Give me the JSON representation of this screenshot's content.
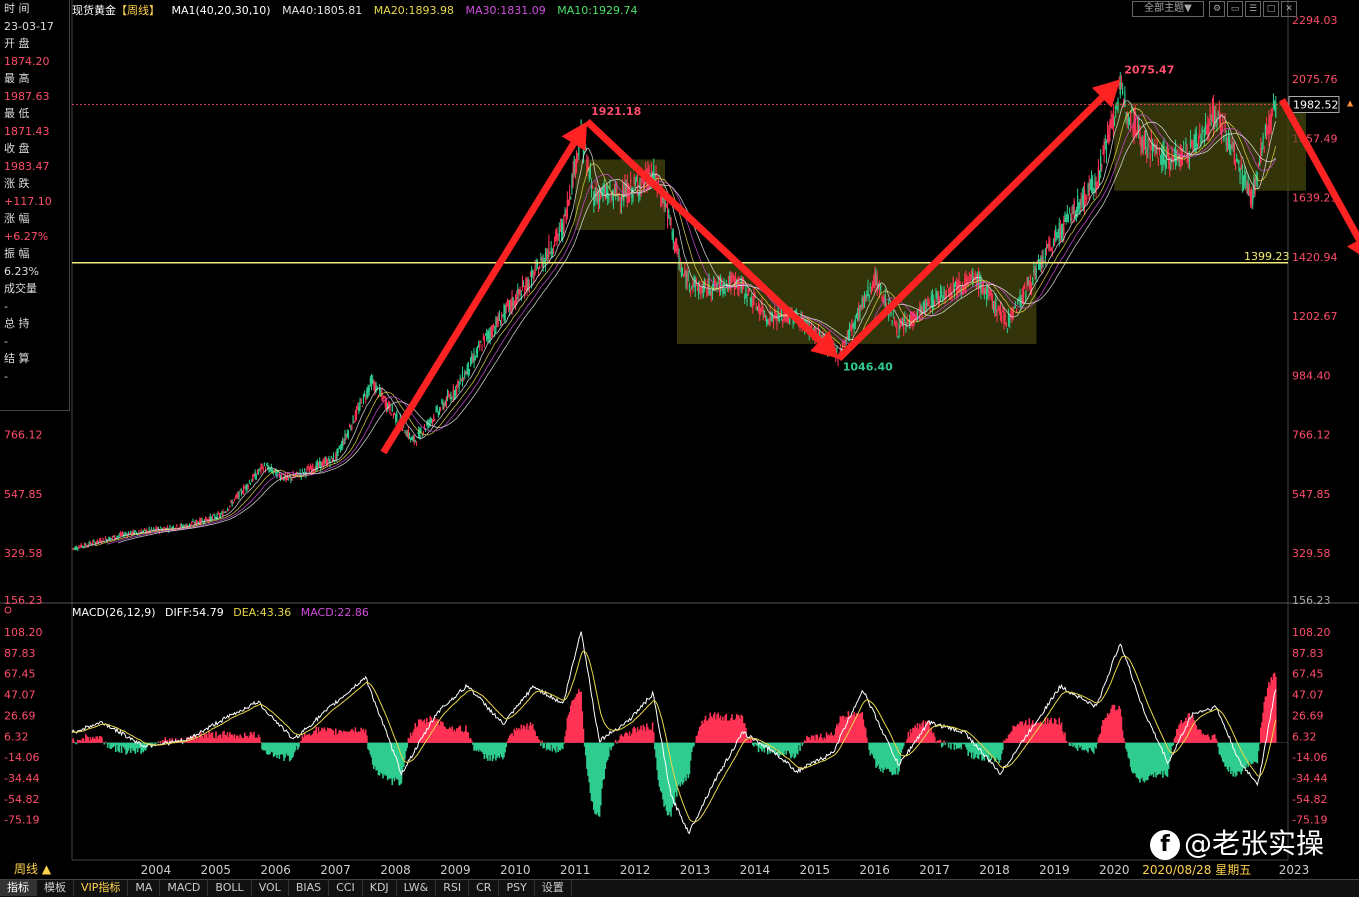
{
  "header": {
    "symbol": "现货黄金",
    "period": "【周线】",
    "ma_label": "MA1(40,20,30,10)",
    "ma40": "MA40:1805.81",
    "ma20": "MA20:1893.98",
    "ma30": "MA30:1831.09",
    "ma10": "MA10:1929.74",
    "theme_button": "全部主题▼"
  },
  "sidebar": {
    "rows": [
      {
        "label": "时 间",
        "value": "23-03-17"
      },
      {
        "label": "开 盘",
        "value": "1874.20"
      },
      {
        "label": "最 高",
        "value": "1987.63"
      },
      {
        "label": "最 低",
        "value": "1871.43"
      },
      {
        "label": "收 盘",
        "value": "1983.47"
      },
      {
        "label": "涨 跌",
        "value": "+117.10"
      },
      {
        "label": "涨 幅",
        "value": "+6.27%"
      },
      {
        "label": "振 幅",
        "value": "6.23%"
      },
      {
        "label": "成交量",
        "value": "-"
      },
      {
        "label": "总 持",
        "value": "-"
      },
      {
        "label": "结 算",
        "value": "-"
      }
    ]
  },
  "macd_header": {
    "title": "MACD(26,12,9)",
    "diff": "DIFF:54.79",
    "dea": "DEA:43.36",
    "macd": "MACD:22.86"
  },
  "annotations": {
    "peak1": "1921.18",
    "peak2": "2075.47",
    "trough": "1046.40",
    "hline": "1399.23",
    "current": "1982.52",
    "cursor_date": "2020/08/28 星期五"
  },
  "bottom_tabs": [
    "指标",
    "模板",
    "VIP指标",
    "MA",
    "MACD",
    "BOLL",
    "VOL",
    "BIAS",
    "CCI",
    "KDJ",
    "LW&",
    "RSI",
    "CR",
    "PSY",
    "设置"
  ],
  "period_button": "周线 ▲",
  "watermark": "@老张实操",
  "colors": {
    "up": "#ff3355",
    "down": "#2ecc8f",
    "ma10": "#e8e8e8",
    "ma20": "#e8d84a",
    "ma30": "#d24de0",
    "ma40": "#e8e8e8",
    "zone": "#4a4a10",
    "arrow": "#ff2222",
    "hline": "#f4ec7a"
  },
  "chart_data": [
    {
      "type": "candlestick",
      "title": "现货黄金【周线】",
      "y_ticks": [
        2294.03,
        2075.76,
        1857.49,
        1639.21,
        1420.94,
        1202.67,
        984.4,
        766.12,
        547.85,
        329.58,
        156.23
      ],
      "ylim": [
        156.23,
        2294.03
      ],
      "x_ticks": [
        "2004",
        "2005",
        "2006",
        "2007",
        "2008",
        "2009",
        "2010",
        "2011",
        "2012",
        "2013",
        "2014",
        "2015",
        "2016",
        "2017",
        "2018",
        "2019",
        "2020",
        "2023"
      ],
      "xlim": [
        2003.1,
        2023.4
      ],
      "price_path": [
        [
          2003.1,
          345
        ],
        [
          2004.0,
          400
        ],
        [
          2005.0,
          430
        ],
        [
          2005.6,
          470
        ],
        [
          2006.3,
          650
        ],
        [
          2006.7,
          600
        ],
        [
          2007.5,
          680
        ],
        [
          2008.1,
          960
        ],
        [
          2008.8,
          740
        ],
        [
          2009.5,
          930
        ],
        [
          2010.0,
          1120
        ],
        [
          2010.8,
          1350
        ],
        [
          2011.3,
          1530
        ],
        [
          2011.6,
          1880
        ],
        [
          2011.8,
          1650
        ],
        [
          2012.3,
          1650
        ],
        [
          2012.8,
          1720
        ],
        [
          2013.0,
          1620
        ],
        [
          2013.3,
          1350
        ],
        [
          2013.6,
          1300
        ],
        [
          2014.2,
          1330
        ],
        [
          2014.7,
          1200
        ],
        [
          2015.2,
          1200
        ],
        [
          2015.9,
          1060
        ],
        [
          2016.5,
          1340
        ],
        [
          2016.9,
          1150
        ],
        [
          2017.7,
          1300
        ],
        [
          2018.2,
          1340
        ],
        [
          2018.7,
          1180
        ],
        [
          2019.0,
          1290
        ],
        [
          2019.6,
          1520
        ],
        [
          2020.2,
          1700
        ],
        [
          2020.6,
          2030
        ],
        [
          2021.0,
          1840
        ],
        [
          2021.4,
          1780
        ],
        [
          2021.7,
          1800
        ],
        [
          2022.2,
          1950
        ],
        [
          2022.8,
          1640
        ],
        [
          2023.0,
          1850
        ],
        [
          2023.2,
          1983
        ]
      ],
      "ma_series": [
        {
          "name": "MA10",
          "value": 1929.74
        },
        {
          "name": "MA20",
          "value": 1893.98
        },
        {
          "name": "MA30",
          "value": 1831.09
        },
        {
          "name": "MA40",
          "value": 1805.81
        }
      ],
      "zones": [
        {
          "x": [
            2011.5,
            2013.0
          ],
          "y": [
            1520,
            1780
          ]
        },
        {
          "x": [
            2013.2,
            2019.2
          ],
          "y": [
            1100,
            1400
          ]
        },
        {
          "x": [
            2020.5,
            2023.7
          ],
          "y": [
            1665,
            1990
          ]
        }
      ],
      "arrows": [
        [
          [
            2008.3,
            700
          ],
          [
            2011.7,
            1920
          ]
        ],
        [
          [
            2011.7,
            1920
          ],
          [
            2015.9,
            1046
          ]
        ],
        [
          [
            2015.9,
            1046
          ],
          [
            2020.6,
            2075
          ]
        ],
        [
          [
            2023.3,
            2000
          ],
          [
            2024.8,
            1400
          ]
        ]
      ],
      "hline": 1399.23,
      "current_line": 1982.52,
      "peaks": [
        {
          "x": 2011.7,
          "y": 1921.18
        },
        {
          "x": 2020.6,
          "y": 2075.47
        },
        {
          "x": 2015.9,
          "y": 1046.4
        }
      ]
    },
    {
      "type": "macd",
      "title": "MACD(26,12,9)",
      "y_ticks": [
        108.2,
        87.83,
        67.45,
        47.07,
        26.69,
        6.32,
        -14.06,
        -34.44,
        -54.82,
        -75.19
      ],
      "ylim": [
        -95,
        115
      ],
      "diff_path": [
        [
          2003.1,
          10
        ],
        [
          2003.6,
          20
        ],
        [
          2004.3,
          -3
        ],
        [
          2005.0,
          2
        ],
        [
          2005.6,
          22
        ],
        [
          2006.2,
          40
        ],
        [
          2006.8,
          3
        ],
        [
          2007.4,
          34
        ],
        [
          2008.0,
          64
        ],
        [
          2008.6,
          -30
        ],
        [
          2009.2,
          30
        ],
        [
          2009.7,
          56
        ],
        [
          2010.3,
          18
        ],
        [
          2010.8,
          55
        ],
        [
          2011.3,
          38
        ],
        [
          2011.6,
          110
        ],
        [
          2011.9,
          2
        ],
        [
          2012.4,
          22
        ],
        [
          2012.8,
          48
        ],
        [
          2013.1,
          -52
        ],
        [
          2013.4,
          -88
        ],
        [
          2013.8,
          -40
        ],
        [
          2014.3,
          10
        ],
        [
          2014.8,
          -8
        ],
        [
          2015.2,
          -28
        ],
        [
          2015.8,
          -10
        ],
        [
          2016.3,
          52
        ],
        [
          2016.9,
          -22
        ],
        [
          2017.4,
          20
        ],
        [
          2018.0,
          10
        ],
        [
          2018.6,
          -30
        ],
        [
          2019.0,
          4
        ],
        [
          2019.6,
          55
        ],
        [
          2020.2,
          35
        ],
        [
          2020.6,
          98
        ],
        [
          2021.0,
          30
        ],
        [
          2021.4,
          -20
        ],
        [
          2021.8,
          28
        ],
        [
          2022.2,
          35
        ],
        [
          2022.6,
          -20
        ],
        [
          2022.9,
          -40
        ],
        [
          2023.2,
          55
        ]
      ],
      "dea_lag": 0.15
    }
  ]
}
